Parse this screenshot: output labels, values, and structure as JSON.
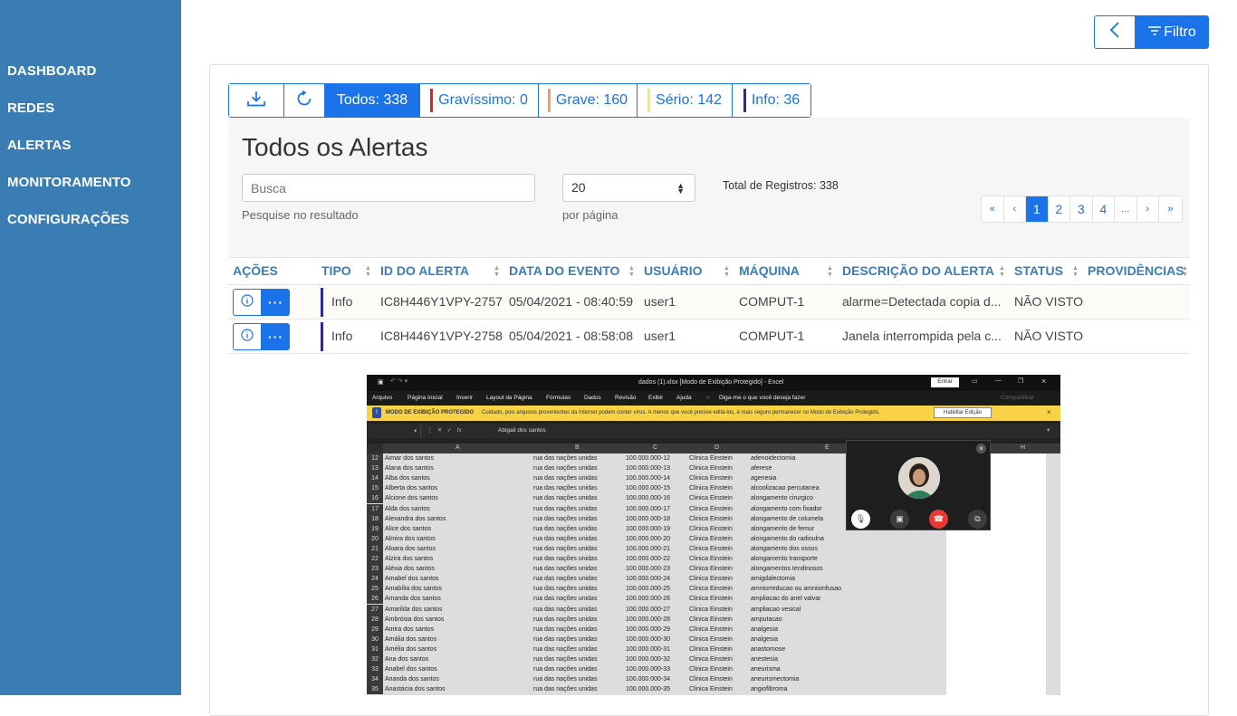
{
  "sidebar": {
    "items": [
      {
        "label": "DASHBOARD"
      },
      {
        "label": "REDES"
      },
      {
        "label": "ALERTAS"
      },
      {
        "label": "MONITORAMENTO"
      },
      {
        "label": "CONFIGURAÇÕES"
      }
    ]
  },
  "toolbar": {
    "filter_label": "Filtro"
  },
  "tabs": [
    {
      "label": "Todos: 338",
      "active": true
    },
    {
      "label": "Gravíssimo: 0",
      "color": "#d9261c"
    },
    {
      "label": "Grave: 160",
      "color": "#f0a064"
    },
    {
      "label": "Sério: 142",
      "color": "#f5e86a"
    },
    {
      "label": "Info: 36",
      "color": "#2b2b9b"
    }
  ],
  "main": {
    "title": "Todos os Alertas",
    "search_placeholder": "Busca",
    "search_help": "Pesquise no resultado",
    "page_size": "20",
    "page_size_help": "por página",
    "total_label": "Total de Registros: 338"
  },
  "pager": [
    "«",
    "‹",
    "1",
    "2",
    "3",
    "4",
    "...",
    "›",
    "»"
  ],
  "table": {
    "headers": [
      "AÇÕES",
      "TIPO",
      "ID DO ALERTA",
      "DATA DO EVENTO",
      "USUÁRIO",
      "MÁQUINA",
      "DESCRIÇÃO DO ALERTA",
      "STATUS",
      "PROVIDÊNCIAS"
    ],
    "rows": [
      {
        "tipo": "Info",
        "id": "IC8H446Y1VPY-2757",
        "data": "05/04/2021 - 08:40:59",
        "usuario": "user1",
        "maquina": "COMPUT-1",
        "descricao": "alarme=Detectada copia d...",
        "status": "NÃO VISTO"
      },
      {
        "tipo": "Info",
        "id": "IC8H446Y1VPY-2758",
        "data": "05/04/2021 - 08:58:08",
        "usuario": "user1",
        "maquina": "COMPUT-1",
        "descricao": "Janela interrompida pela c...",
        "status": "NÃO VISTO"
      }
    ]
  },
  "screenshot": {
    "window_title": "dados (1).xlsx  [Modo de Exibição Protegido]  -  Excel",
    "enter_label": "Entrar",
    "ribbon": [
      "Arquivo",
      "Página Inicial",
      "Inserir",
      "Layout da Página",
      "Fórmulas",
      "Dados",
      "Revisão",
      "Exibir",
      "Ajuda",
      "Diga-me o que você deseja fazer"
    ],
    "share_label": "Compartilhar",
    "protected_title": "MODO DE EXIBIÇÃO PROTEGIDO",
    "protected_msg": "Cuidado, pois arquivos provenientes da Internet podem conter vírus. A menos que você precise editá-los, é mais seguro permanecer no Modo de Exibição Protegido.",
    "enable_edit_label": "Habilitar Edição",
    "formula_value": "Abigail dos santos",
    "columns": [
      "A",
      "B",
      "C",
      "D",
      "E",
      "H"
    ],
    "rows": [
      {
        "n": "12",
        "a": "Aimar dos santos",
        "b": "rua das nações unidas",
        "c": "100.000.000-12",
        "d": "Clinica Einstein",
        "e": "adenoidectomia"
      },
      {
        "n": "13",
        "a": "Alana dos santos",
        "b": "rua das nações unidas",
        "c": "100.000.000-13",
        "d": "Clinica Einstein",
        "e": "aferese"
      },
      {
        "n": "14",
        "a": "Alba dos santos",
        "b": "rua das nações unidas",
        "c": "100.000.000-14",
        "d": "Clinica Einstein",
        "e": "agenesia"
      },
      {
        "n": "15",
        "a": "Alberta dos santos",
        "b": "rua das nações unidas",
        "c": "100.000.000-15",
        "d": "Clinica Einstein",
        "e": "alcoolizacao percutanea"
      },
      {
        "n": "16",
        "a": "Alcione dos santos",
        "b": "rua das nações unidas",
        "c": "100.000.000-16",
        "d": "Clinica Einstein",
        "e": "alongamento cirurgico"
      },
      {
        "n": "17",
        "a": "Alda dos santos",
        "b": "rua das nações unidas",
        "c": "100.000.000-17",
        "d": "Clinica Einstein",
        "e": "alongamento com fixador"
      },
      {
        "n": "18",
        "a": "Alexandra dos santos",
        "b": "rua das nações unidas",
        "c": "100.000.000-18",
        "d": "Clinica Einstein",
        "e": "alongamento de columela"
      },
      {
        "n": "19",
        "a": "Alice dos santos",
        "b": "rua das nações unidas",
        "c": "100.000.000-19",
        "d": "Clinica Einstein",
        "e": "alongamento de femur"
      },
      {
        "n": "20",
        "a": "Almira dos santos",
        "b": "rua das nações unidas",
        "c": "100.000.000-20",
        "d": "Clinica Einstein",
        "e": "alongamento do radioulna"
      },
      {
        "n": "21",
        "a": "Aloara dos santos",
        "b": "rua das nações unidas",
        "c": "100.000.000-21",
        "d": "Clinica Einstein",
        "e": "alongamento dos ossos"
      },
      {
        "n": "22",
        "a": "Alzira dos santos",
        "b": "rua das nações unidas",
        "c": "100.000.000-22",
        "d": "Clinica Einstein",
        "e": "alongamento transporte"
      },
      {
        "n": "23",
        "a": "Aléxia dos santos",
        "b": "rua das nações unidas",
        "c": "100.000.000-23",
        "d": "Clinica Einstein",
        "e": "alongamentos tendinosos"
      },
      {
        "n": "24",
        "a": "Amabel dos santos",
        "b": "rua das nações unidas",
        "c": "100.000.000-24",
        "d": "Clinica Einstein",
        "e": "amigdalectomia"
      },
      {
        "n": "25",
        "a": "Amabília dos santos",
        "b": "rua das nações unidas",
        "c": "100.000.000-25",
        "d": "Clinica Einstein",
        "e": "amniorreducao ou amnioinfusao"
      },
      {
        "n": "26",
        "a": "Amanda dos santos",
        "b": "rua das nações unidas",
        "c": "100.000.000-26",
        "d": "Clinica Einstein",
        "e": "ampliacao do anel valvar"
      },
      {
        "n": "27",
        "a": "Amarilda dos santos",
        "b": "rua das nações unidas",
        "c": "100.000.000-27",
        "d": "Clinica Einstein",
        "e": "ampliacao vesical"
      },
      {
        "n": "28",
        "a": "Ambrósia dos santos",
        "b": "rua das nações unidas",
        "c": "100.000.000-28",
        "d": "Clinica Einstein",
        "e": "amputacao"
      },
      {
        "n": "29",
        "a": "Amira dos santos",
        "b": "rua das nações unidas",
        "c": "100.000.000-29",
        "d": "Clinica Einstein",
        "e": "analgesia"
      },
      {
        "n": "30",
        "a": "Amália dos santos",
        "b": "rua das nações unidas",
        "c": "100.000.000-30",
        "d": "Clinica Einstein",
        "e": "analgesia"
      },
      {
        "n": "31",
        "a": "Amélia dos santos",
        "b": "rua das nações unidas",
        "c": "100.000.000-31",
        "d": "Clinica Einstein",
        "e": "anastomose"
      },
      {
        "n": "32",
        "a": "Ana dos santos",
        "b": "rua das nações unidas",
        "c": "100.000.000-32",
        "d": "Clinica Einstein",
        "e": "anestesia"
      },
      {
        "n": "33",
        "a": "Anabel dos santos",
        "b": "rua das nações unidas",
        "c": "100.000.000-33",
        "d": "Clinica Einstein",
        "e": "aneurisma"
      },
      {
        "n": "34",
        "a": "Ananda dos santos",
        "b": "rua das nações unidas",
        "c": "100.000.000-34",
        "d": "Clinica Einstein",
        "e": "aneurismectomia"
      },
      {
        "n": "35",
        "a": "Anastácia dos santos",
        "b": "rua das nações unidas",
        "c": "100.000.000-35",
        "d": "Clinica Einstein",
        "e": "angiofibroma"
      }
    ]
  }
}
